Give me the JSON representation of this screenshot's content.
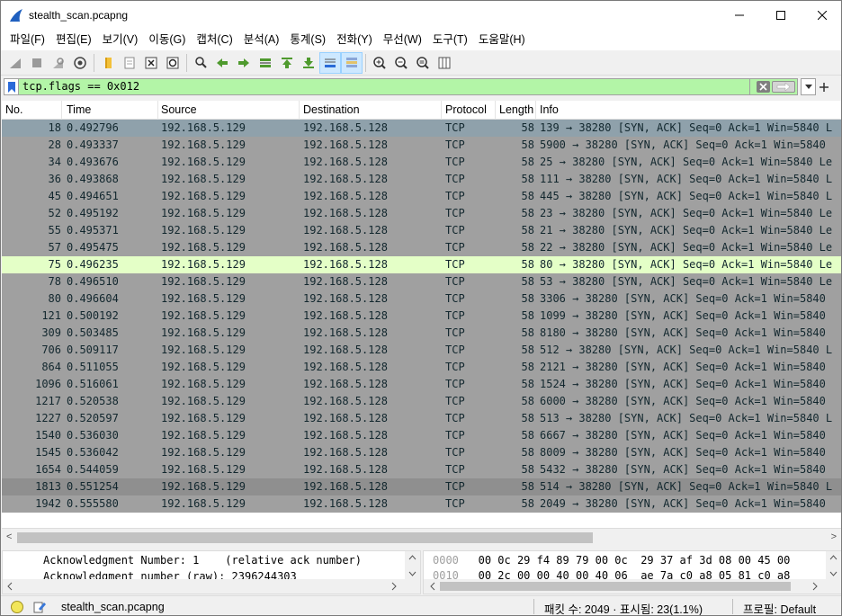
{
  "window": {
    "title": "stealth_scan.pcapng"
  },
  "menu": [
    "파일(F)",
    "편집(E)",
    "보기(V)",
    "이동(G)",
    "캡처(C)",
    "분석(A)",
    "통계(S)",
    "전화(Y)",
    "무선(W)",
    "도구(T)",
    "도움말(H)"
  ],
  "filter": {
    "value": "tcp.flags == 0x012"
  },
  "columns": {
    "no": "No.",
    "time": "Time",
    "source": "Source",
    "destination": "Destination",
    "protocol": "Protocol",
    "length": "Length",
    "info": "Info"
  },
  "packets": [
    {
      "no": "18",
      "time": "0.492796",
      "src": "192.168.5.129",
      "dst": "192.168.5.128",
      "proto": "TCP",
      "len": "58",
      "info": "139 → 38280 [SYN, ACK] Seq=0 Ack=1 Win=5840 L"
    },
    {
      "no": "28",
      "time": "0.493337",
      "src": "192.168.5.129",
      "dst": "192.168.5.128",
      "proto": "TCP",
      "len": "58",
      "info": "5900 → 38280 [SYN, ACK] Seq=0 Ack=1 Win=5840"
    },
    {
      "no": "34",
      "time": "0.493676",
      "src": "192.168.5.129",
      "dst": "192.168.5.128",
      "proto": "TCP",
      "len": "58",
      "info": "25 → 38280 [SYN, ACK] Seq=0 Ack=1 Win=5840 Le"
    },
    {
      "no": "36",
      "time": "0.493868",
      "src": "192.168.5.129",
      "dst": "192.168.5.128",
      "proto": "TCP",
      "len": "58",
      "info": "111 → 38280 [SYN, ACK] Seq=0 Ack=1 Win=5840 L"
    },
    {
      "no": "45",
      "time": "0.494651",
      "src": "192.168.5.129",
      "dst": "192.168.5.128",
      "proto": "TCP",
      "len": "58",
      "info": "445 → 38280 [SYN, ACK] Seq=0 Ack=1 Win=5840 L"
    },
    {
      "no": "52",
      "time": "0.495192",
      "src": "192.168.5.129",
      "dst": "192.168.5.128",
      "proto": "TCP",
      "len": "58",
      "info": "23 → 38280 [SYN, ACK] Seq=0 Ack=1 Win=5840 Le"
    },
    {
      "no": "55",
      "time": "0.495371",
      "src": "192.168.5.129",
      "dst": "192.168.5.128",
      "proto": "TCP",
      "len": "58",
      "info": "21 → 38280 [SYN, ACK] Seq=0 Ack=1 Win=5840 Le"
    },
    {
      "no": "57",
      "time": "0.495475",
      "src": "192.168.5.129",
      "dst": "192.168.5.128",
      "proto": "TCP",
      "len": "58",
      "info": "22 → 38280 [SYN, ACK] Seq=0 Ack=1 Win=5840 Le"
    },
    {
      "no": "75",
      "time": "0.496235",
      "src": "192.168.5.129",
      "dst": "192.168.5.128",
      "proto": "TCP",
      "len": "58",
      "info": "80 → 38280 [SYN, ACK] Seq=0 Ack=1 Win=5840 Le"
    },
    {
      "no": "78",
      "time": "0.496510",
      "src": "192.168.5.129",
      "dst": "192.168.5.128",
      "proto": "TCP",
      "len": "58",
      "info": "53 → 38280 [SYN, ACK] Seq=0 Ack=1 Win=5840 Le"
    },
    {
      "no": "80",
      "time": "0.496604",
      "src": "192.168.5.129",
      "dst": "192.168.5.128",
      "proto": "TCP",
      "len": "58",
      "info": "3306 → 38280 [SYN, ACK] Seq=0 Ack=1 Win=5840"
    },
    {
      "no": "121",
      "time": "0.500192",
      "src": "192.168.5.129",
      "dst": "192.168.5.128",
      "proto": "TCP",
      "len": "58",
      "info": "1099 → 38280 [SYN, ACK] Seq=0 Ack=1 Win=5840"
    },
    {
      "no": "309",
      "time": "0.503485",
      "src": "192.168.5.129",
      "dst": "192.168.5.128",
      "proto": "TCP",
      "len": "58",
      "info": "8180 → 38280 [SYN, ACK] Seq=0 Ack=1 Win=5840"
    },
    {
      "no": "706",
      "time": "0.509117",
      "src": "192.168.5.129",
      "dst": "192.168.5.128",
      "proto": "TCP",
      "len": "58",
      "info": "512 → 38280 [SYN, ACK] Seq=0 Ack=1 Win=5840 L"
    },
    {
      "no": "864",
      "time": "0.511055",
      "src": "192.168.5.129",
      "dst": "192.168.5.128",
      "proto": "TCP",
      "len": "58",
      "info": "2121 → 38280 [SYN, ACK] Seq=0 Ack=1 Win=5840"
    },
    {
      "no": "1096",
      "time": "0.516061",
      "src": "192.168.5.129",
      "dst": "192.168.5.128",
      "proto": "TCP",
      "len": "58",
      "info": "1524 → 38280 [SYN, ACK] Seq=0 Ack=1 Win=5840"
    },
    {
      "no": "1217",
      "time": "0.520538",
      "src": "192.168.5.129",
      "dst": "192.168.5.128",
      "proto": "TCP",
      "len": "58",
      "info": "6000 → 38280 [SYN, ACK] Seq=0 Ack=1 Win=5840"
    },
    {
      "no": "1227",
      "time": "0.520597",
      "src": "192.168.5.129",
      "dst": "192.168.5.128",
      "proto": "TCP",
      "len": "58",
      "info": "513 → 38280 [SYN, ACK] Seq=0 Ack=1 Win=5840 L"
    },
    {
      "no": "1540",
      "time": "0.536030",
      "src": "192.168.5.129",
      "dst": "192.168.5.128",
      "proto": "TCP",
      "len": "58",
      "info": "6667 → 38280 [SYN, ACK] Seq=0 Ack=1 Win=5840"
    },
    {
      "no": "1545",
      "time": "0.536042",
      "src": "192.168.5.129",
      "dst": "192.168.5.128",
      "proto": "TCP",
      "len": "58",
      "info": "8009 → 38280 [SYN, ACK] Seq=0 Ack=1 Win=5840"
    },
    {
      "no": "1654",
      "time": "0.544059",
      "src": "192.168.5.129",
      "dst": "192.168.5.128",
      "proto": "TCP",
      "len": "58",
      "info": "5432 → 38280 [SYN, ACK] Seq=0 Ack=1 Win=5840"
    },
    {
      "no": "1813",
      "time": "0.551254",
      "src": "192.168.5.129",
      "dst": "192.168.5.128",
      "proto": "TCP",
      "len": "58",
      "info": "514 → 38280 [SYN, ACK] Seq=0 Ack=1 Win=5840 L"
    },
    {
      "no": "1942",
      "time": "0.555580",
      "src": "192.168.5.129",
      "dst": "192.168.5.128",
      "proto": "TCP",
      "len": "58",
      "info": "2049 → 38280 [SYN, ACK] Seq=0 Ack=1 Win=5840"
    }
  ],
  "details": {
    "line1": "Acknowledgment Number: 1    (relative ack number)",
    "line2": "Acknowledgment number (raw): 2396244303"
  },
  "bytes": {
    "line1_offset": "0000",
    "line1_hex": "00 0c 29 f4 89 79 00 0c  29 37 af 3d 08 00 45 00",
    "line2_offset": "0010",
    "line2_hex": "00 2c 00 00 40 00 40 06  ae 7a c0 a8 05 81 c0 a8"
  },
  "status": {
    "file": "stealth_scan.pcapng",
    "packets": "패킷 수: 2049 · 표시됨: 23(1.1%)",
    "profile": "프로필: Default"
  },
  "colors": {
    "row_default": "#a0a0a0",
    "row_selected": "#e4ffc7",
    "filter_valid": "#b3f5a7"
  }
}
